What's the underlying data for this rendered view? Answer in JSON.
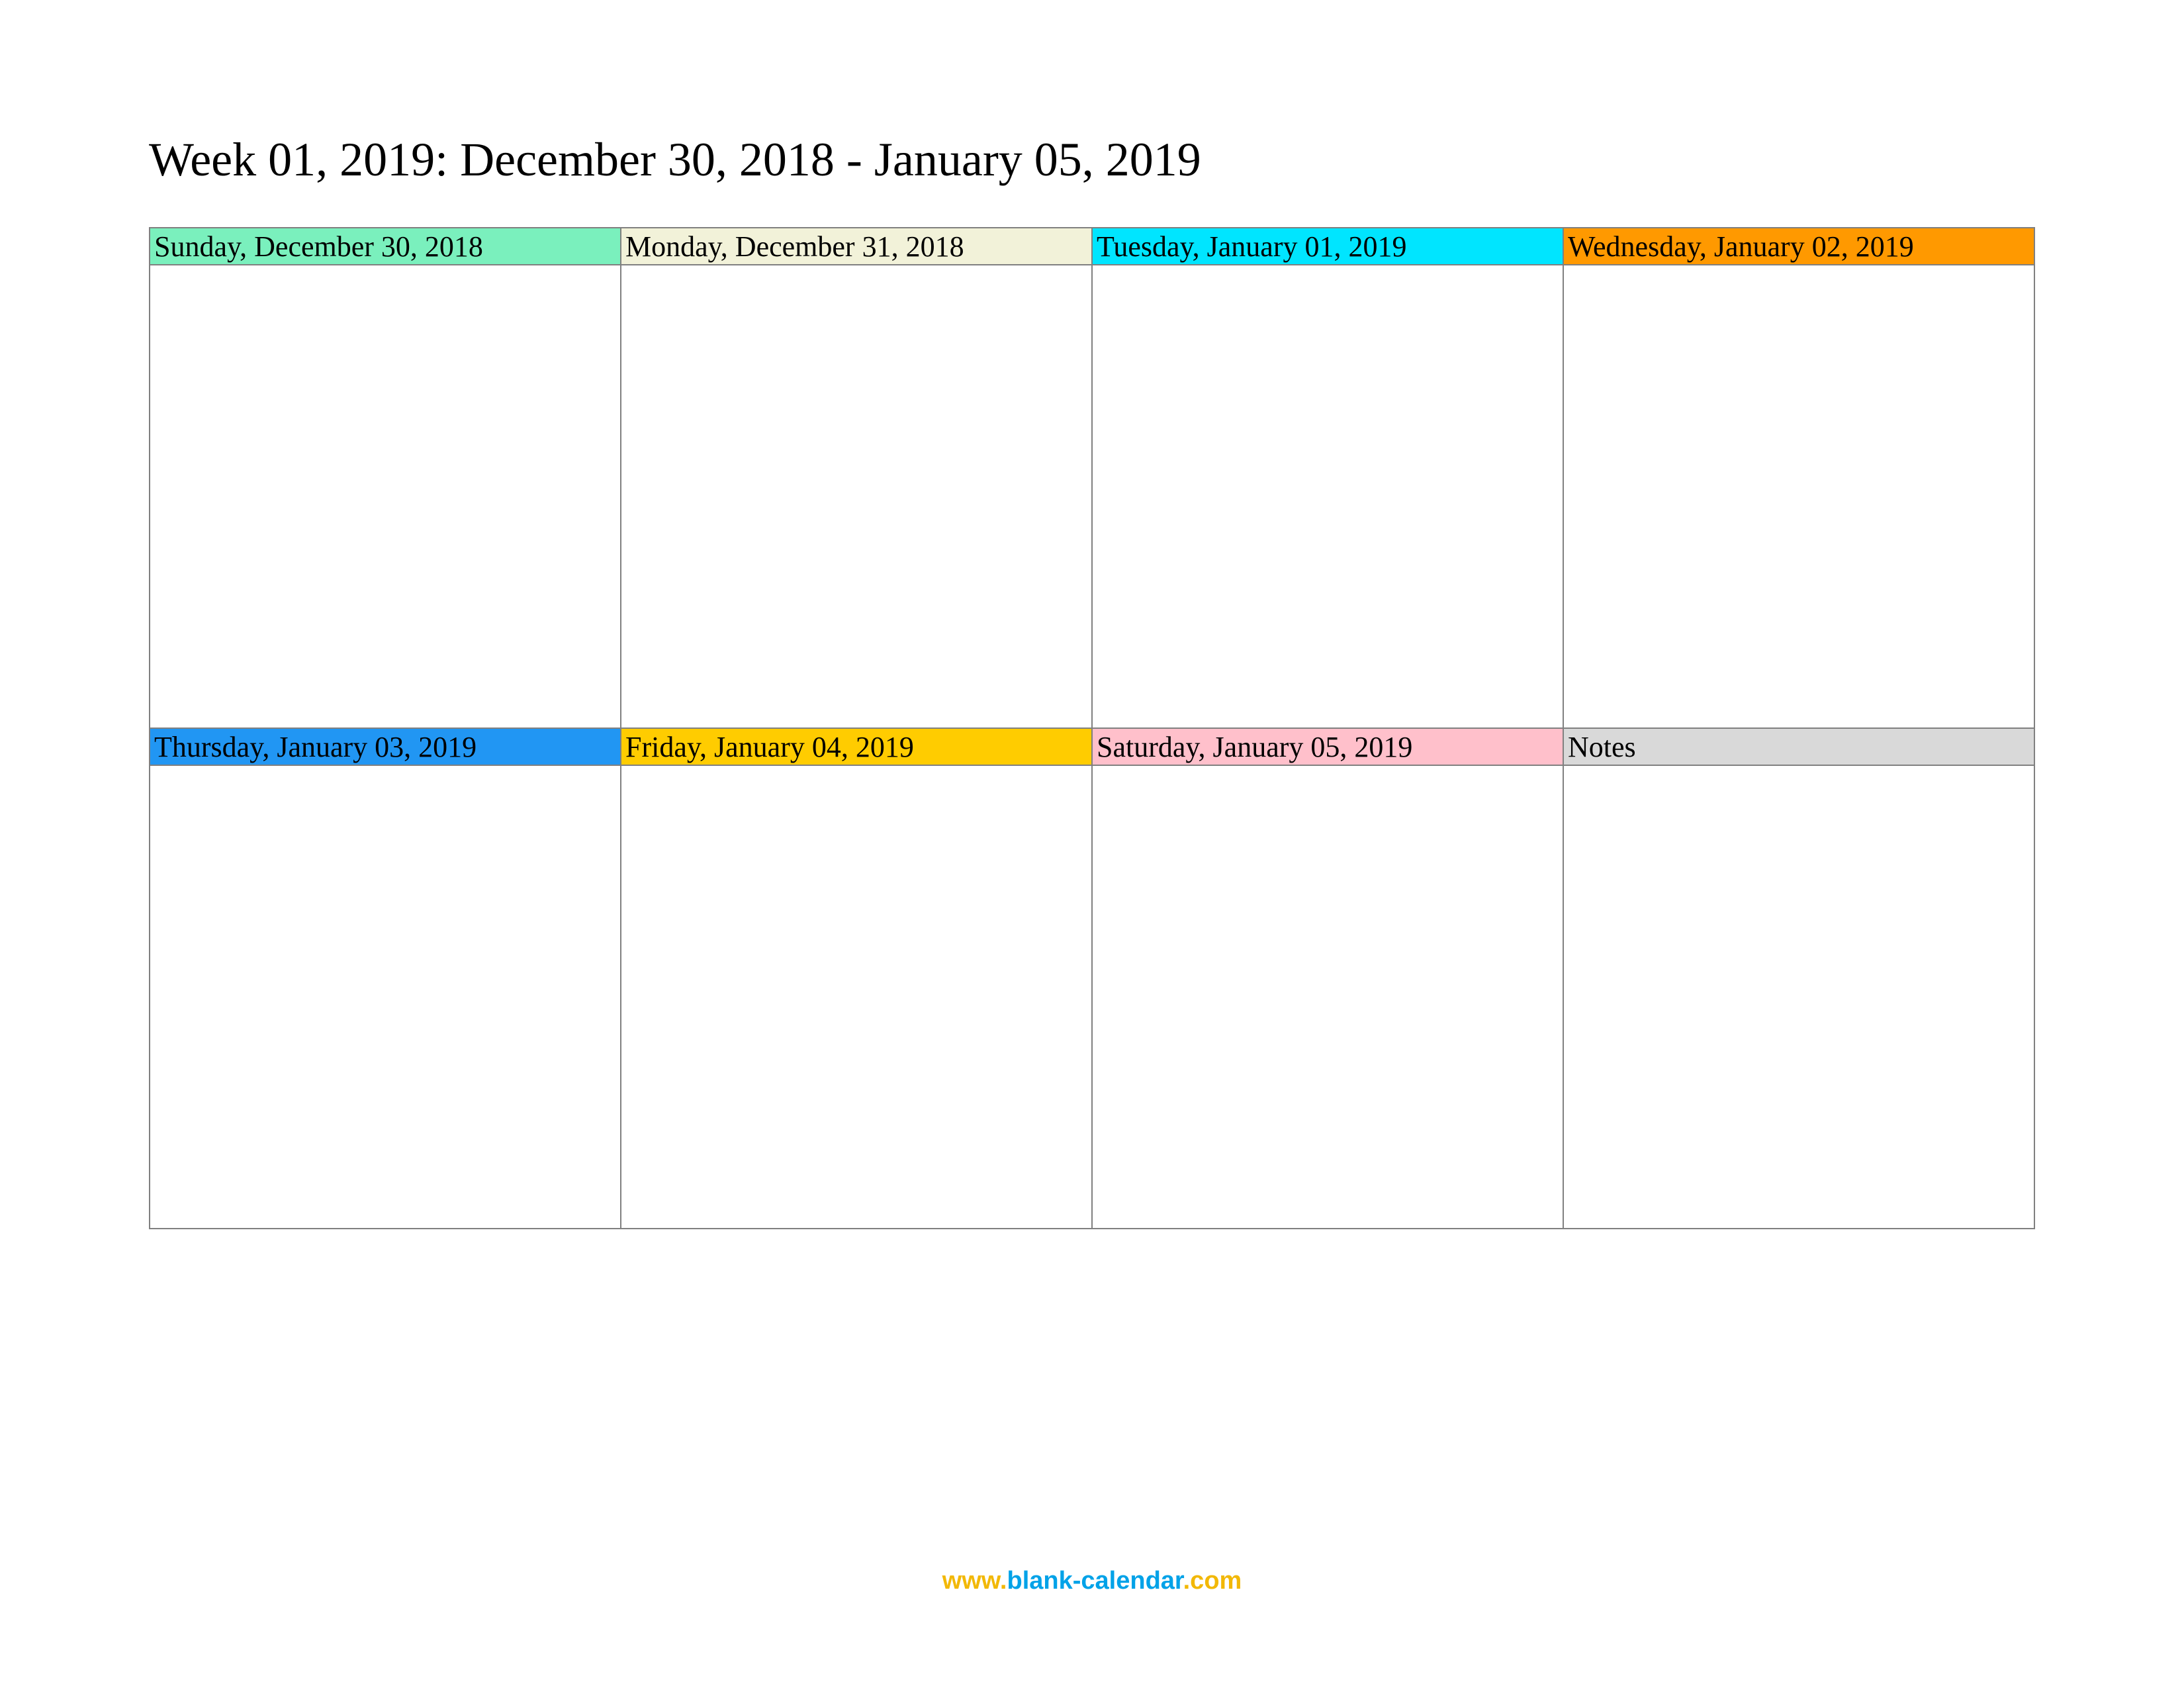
{
  "title": "Week 01, 2019: December 30, 2018 - January 05, 2019",
  "cells": [
    {
      "label": "Sunday, December 30, 2018",
      "color": "#7af0bd"
    },
    {
      "label": "Monday, December 31, 2018",
      "color": "#f2f2d9"
    },
    {
      "label": "Tuesday, January 01, 2019",
      "color": "#00e5ff"
    },
    {
      "label": "Wednesday, January 02, 2019",
      "color": "#ff9900"
    },
    {
      "label": "Thursday, January 03, 2019",
      "color": "#2196f3"
    },
    {
      "label": "Friday, January 04, 2019",
      "color": "#ffcc00"
    },
    {
      "label": "Saturday, January 05, 2019",
      "color": "#ffc0cb"
    },
    {
      "label": "Notes",
      "color": "#d9d9d9"
    }
  ],
  "footer": {
    "www": "www.",
    "domain": "blank-calendar",
    "tld": ".com"
  }
}
